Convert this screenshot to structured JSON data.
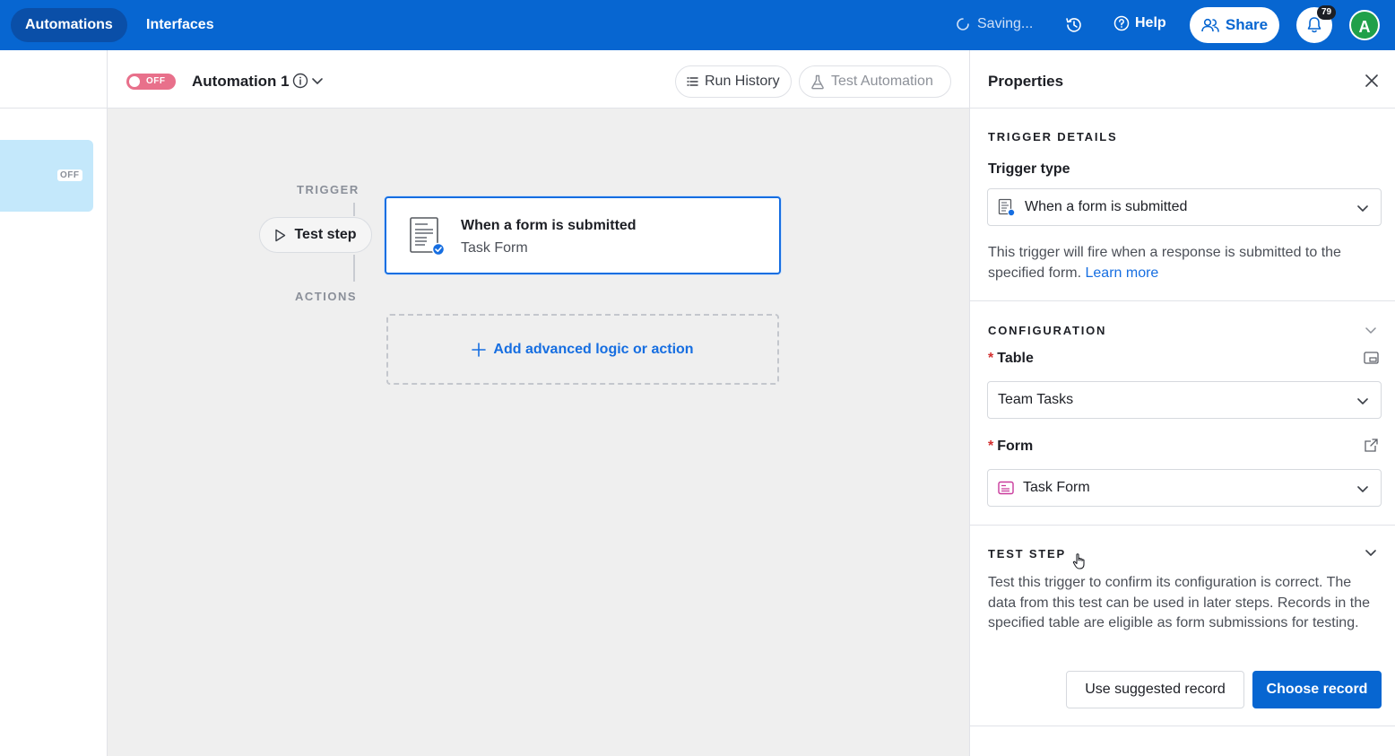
{
  "topbar": {
    "tabs": [
      {
        "label": "Automations",
        "active": true
      },
      {
        "label": "Interfaces",
        "active": false
      }
    ],
    "saving_text": "Saving...",
    "help_label": "Help",
    "share_label": "Share",
    "notification_count": "79",
    "avatar_initial": "A",
    "accent_color": "#0766d1"
  },
  "left_rail": {
    "card_status": "OFF"
  },
  "header": {
    "toggle_label": "OFF",
    "automation_name": "Automation 1",
    "run_history_label": "Run History",
    "test_automation_label": "Test Automation"
  },
  "canvas": {
    "trigger_label": "TRIGGER",
    "actions_label": "ACTIONS",
    "test_step_label": "Test step",
    "trigger_card": {
      "title": "When a form is submitted",
      "subtitle": "Task Form",
      "icon": "form-doc-icon"
    },
    "add_action_label": "Add advanced logic or action"
  },
  "properties": {
    "title": "Properties",
    "trigger_details_heading": "TRIGGER DETAILS",
    "trigger_type_label": "Trigger type",
    "trigger_type_value": "When a form is submitted",
    "trigger_description": "This trigger will fire when a response is submitted to the specified form.",
    "learn_more_label": "Learn more",
    "configuration_heading": "CONFIGURATION",
    "table_label": "Table",
    "table_value": "Team Tasks",
    "form_label": "Form",
    "form_value": "Task Form",
    "test_step_heading": "TEST STEP",
    "test_step_description": "Test this trigger to confirm its configuration is correct. The data from this test can be used in later steps. Records in the specified table are eligible as form submissions for testing.",
    "use_suggested_label": "Use suggested record",
    "choose_record_label": "Choose record"
  }
}
